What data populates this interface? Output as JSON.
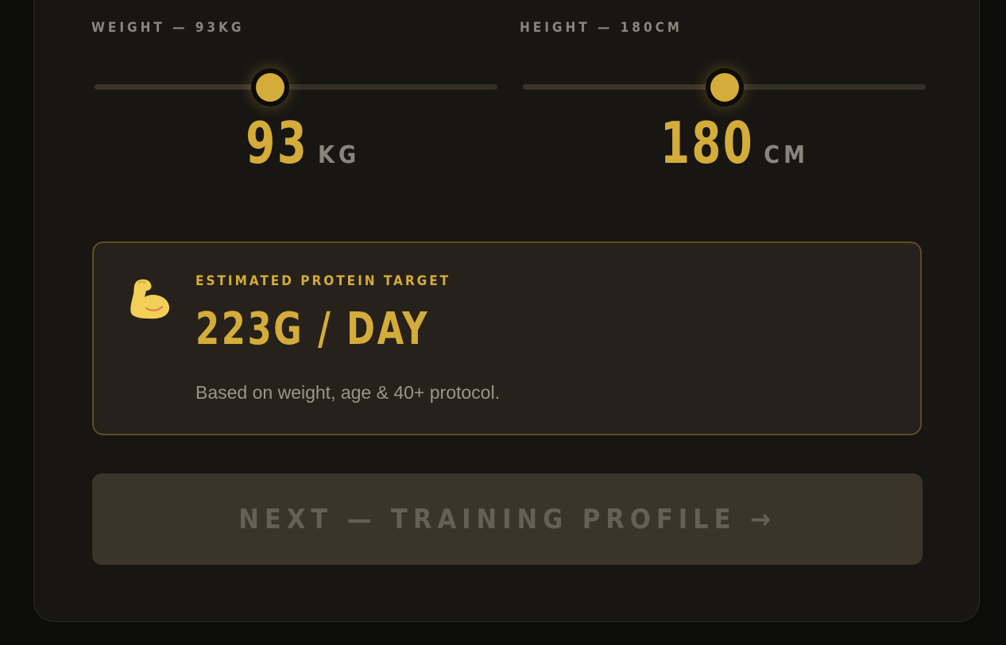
{
  "weight": {
    "label": "WEIGHT — 93KG",
    "value": "93",
    "unit": "KG",
    "slider_fraction": 0.436
  },
  "height": {
    "label": "HEIGHT — 180CM",
    "value": "180",
    "unit": "CM",
    "slider_fraction": 0.5
  },
  "protein": {
    "icon": "flexed-biceps",
    "label": "ESTIMATED PROTEIN TARGET",
    "value": "223G / DAY",
    "note": "Based on weight, age & 40+ protocol."
  },
  "next_button": {
    "label": "NEXT — TRAINING PROFILE →",
    "state": "disabled"
  },
  "colors": {
    "accent": "#d4ac3a",
    "background": "#181613",
    "muted_text": "#8a857c"
  }
}
